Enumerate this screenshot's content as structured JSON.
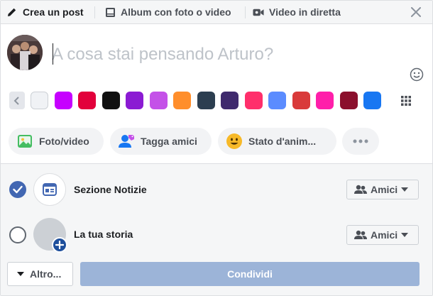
{
  "tabs": {
    "create_post": "Crea un post",
    "album": "Album con foto o video",
    "live": "Video in diretta"
  },
  "composer": {
    "placeholder": "A cosa stai pensando Arturo?"
  },
  "colors": [
    "#f0f2f5",
    "#c600ff",
    "#e2013b",
    "#111111",
    "#8b1bd3",
    "#c451e8",
    "#ff8e2b",
    "#2c3e50",
    "#3f2a6d",
    "#ff2f6b",
    "#5b8cff",
    "#d93a3a",
    "#ff1faa",
    "#8b0f2c",
    "#1877f2"
  ],
  "actions": {
    "photo": "Foto/video",
    "tag": "Tagga amici",
    "mood": "Stato d'anim..."
  },
  "destinations": [
    {
      "label": "Sezione Notizie",
      "audience": "Amici",
      "selected": true
    },
    {
      "label": "La tua storia",
      "audience": "Amici",
      "selected": false
    }
  ],
  "footer": {
    "more": "Altro...",
    "share": "Condividi"
  },
  "accent": "#4267b2"
}
